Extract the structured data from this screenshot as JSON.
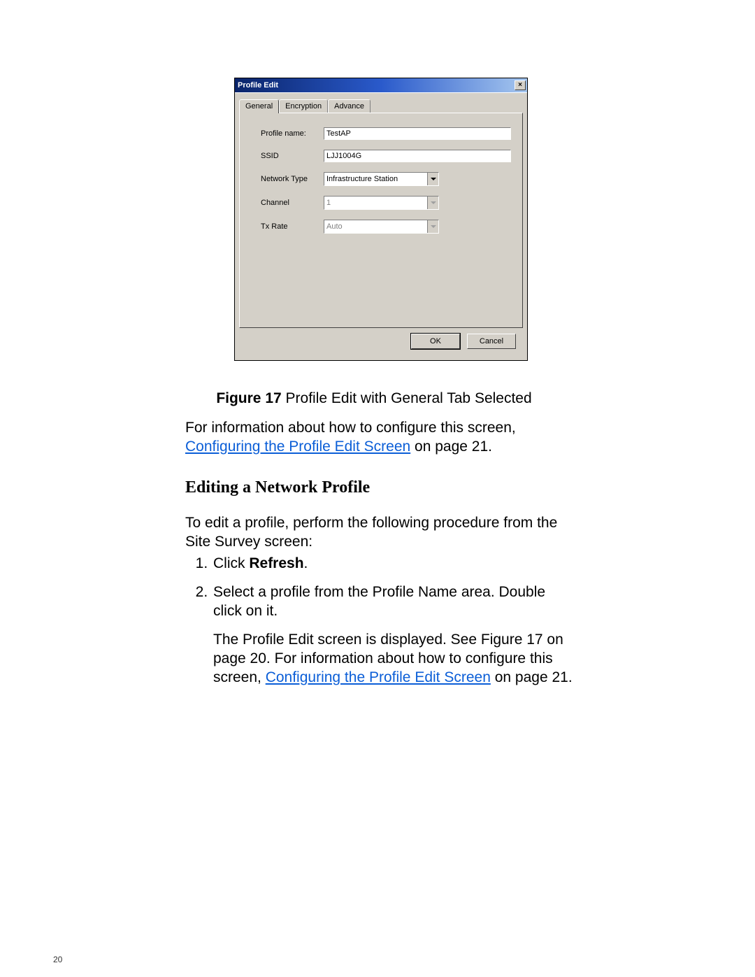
{
  "dialog": {
    "title": "Profile Edit",
    "close_glyph": "×",
    "tabs": {
      "general": "General",
      "encryption": "Encryption",
      "advance": "Advance"
    },
    "fields": {
      "profile_name": {
        "label": "Profile name:",
        "value": "TestAP"
      },
      "ssid": {
        "label": "SSID",
        "value": "LJJ1004G"
      },
      "network_type": {
        "label": "Network Type",
        "value": "Infrastructure Station"
      },
      "channel": {
        "label": "Channel",
        "value": "1"
      },
      "tx_rate": {
        "label": "Tx Rate",
        "value": "Auto"
      }
    },
    "buttons": {
      "ok": "OK",
      "cancel": "Cancel"
    }
  },
  "doc": {
    "figure_label": "Figure 17",
    "figure_caption_rest": "  Profile Edit with General Tab Selected",
    "info_prefix": "For information about how to configure this screen, ",
    "config_link": "Configuring the Profile Edit Screen",
    "info_suffix": " on page 21.",
    "section_title": "Editing a Network Profile",
    "intro": "To edit a profile, perform the following procedure from the Site Survey screen:",
    "step1_prefix": "Click ",
    "step1_bold": "Refresh",
    "step1_suffix": ".",
    "step2": "Select a profile from the Profile Name area. Double click on it.",
    "step2_para_prefix": "The Profile Edit screen is displayed. See Figure 17 on page 20. For information about how to configure this screen, ",
    "step2_para_suffix": " on page 21.",
    "page_number": "20"
  }
}
